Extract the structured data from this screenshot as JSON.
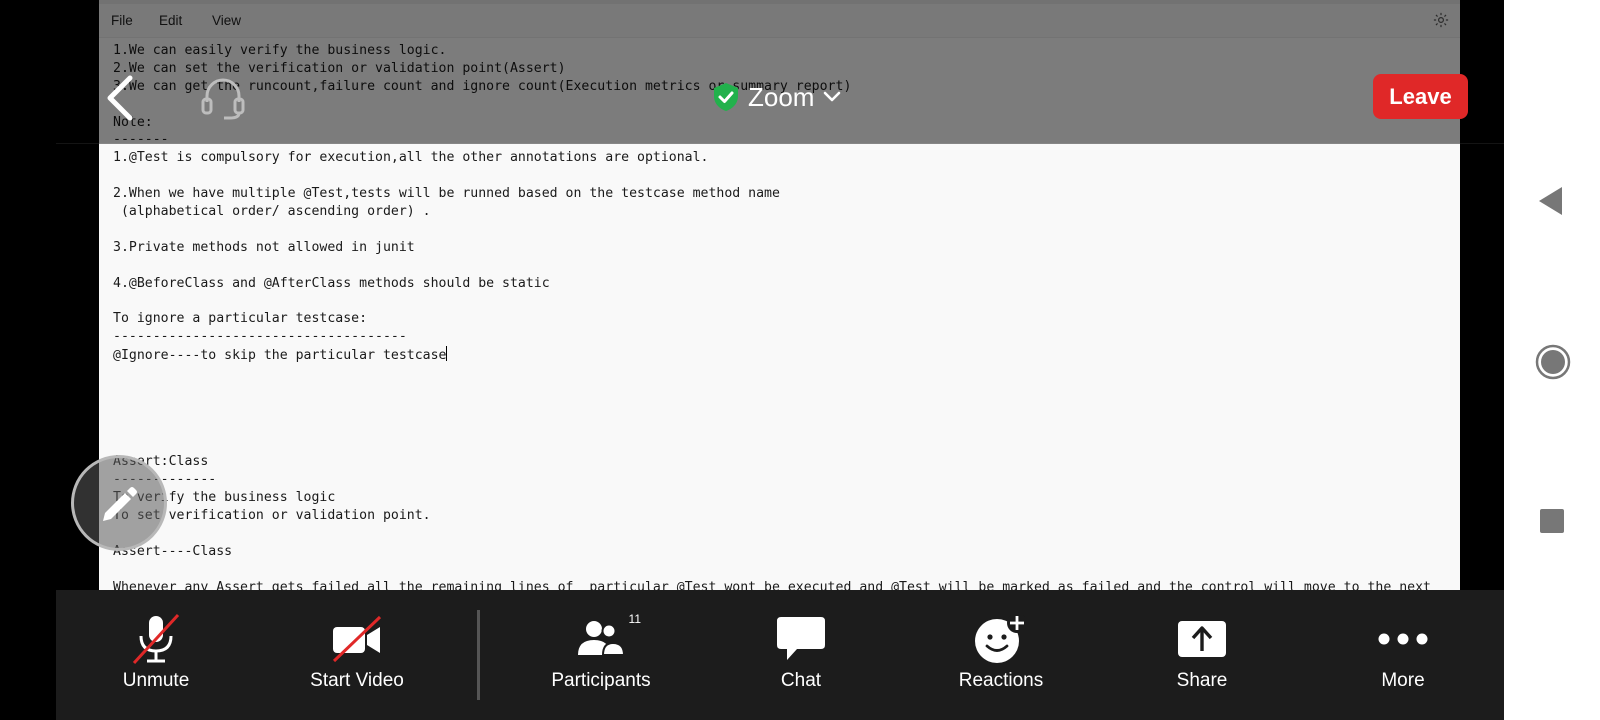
{
  "shared_screen": {
    "menu": [
      "File",
      "Edit",
      "View"
    ],
    "lines": [
      "1.We can easily verify the business logic.",
      "2.We can set the verification or validation point(Assert)",
      "3.We can get the runcount,failure count and ignore count(Execution metrics or summary report)",
      "",
      "Note:",
      "-------",
      "1.@Test is compulsory for execution,all the other annotations are optional.",
      "",
      "2.When we have multiple @Test,tests will be runned based on the testcase method name",
      " (alphabetical order/ ascending order) .",
      "",
      "3.Private methods not allowed in junit",
      "",
      "4.@BeforeClass and @AfterClass methods should be static",
      "",
      "To ignore a particular testcase:",
      "-------------------------------------",
      "@Ignore----to skip the particular testcase",
      "",
      "",
      "",
      "",
      "",
      "Assert:Class",
      "-------------",
      "To verify the business logic",
      "To set verification or validation point.",
      "",
      "Assert----Class",
      "",
      "Whenever any Assert gets failed all the remaining lines of  particular @Test wont be executed and @Test will be marked as failed and the control will move to the next"
    ]
  },
  "topbar": {
    "meeting_name": "Zoom",
    "leave_label": "Leave",
    "colors": {
      "leave": "#e02828",
      "shield": "#22b14c"
    }
  },
  "toolbar": {
    "unmute": "Unmute",
    "start_video": "Start Video",
    "participants": "Participants",
    "participants_count": "11",
    "chat": "Chat",
    "reactions": "Reactions",
    "share": "Share",
    "more": "More"
  },
  "icons": {
    "back": "chevron-left-icon",
    "audio": "headset-icon",
    "security": "shield-check-icon",
    "dropdown": "chevron-down-icon",
    "annotate": "pencil-icon",
    "settings": "gear-icon"
  }
}
